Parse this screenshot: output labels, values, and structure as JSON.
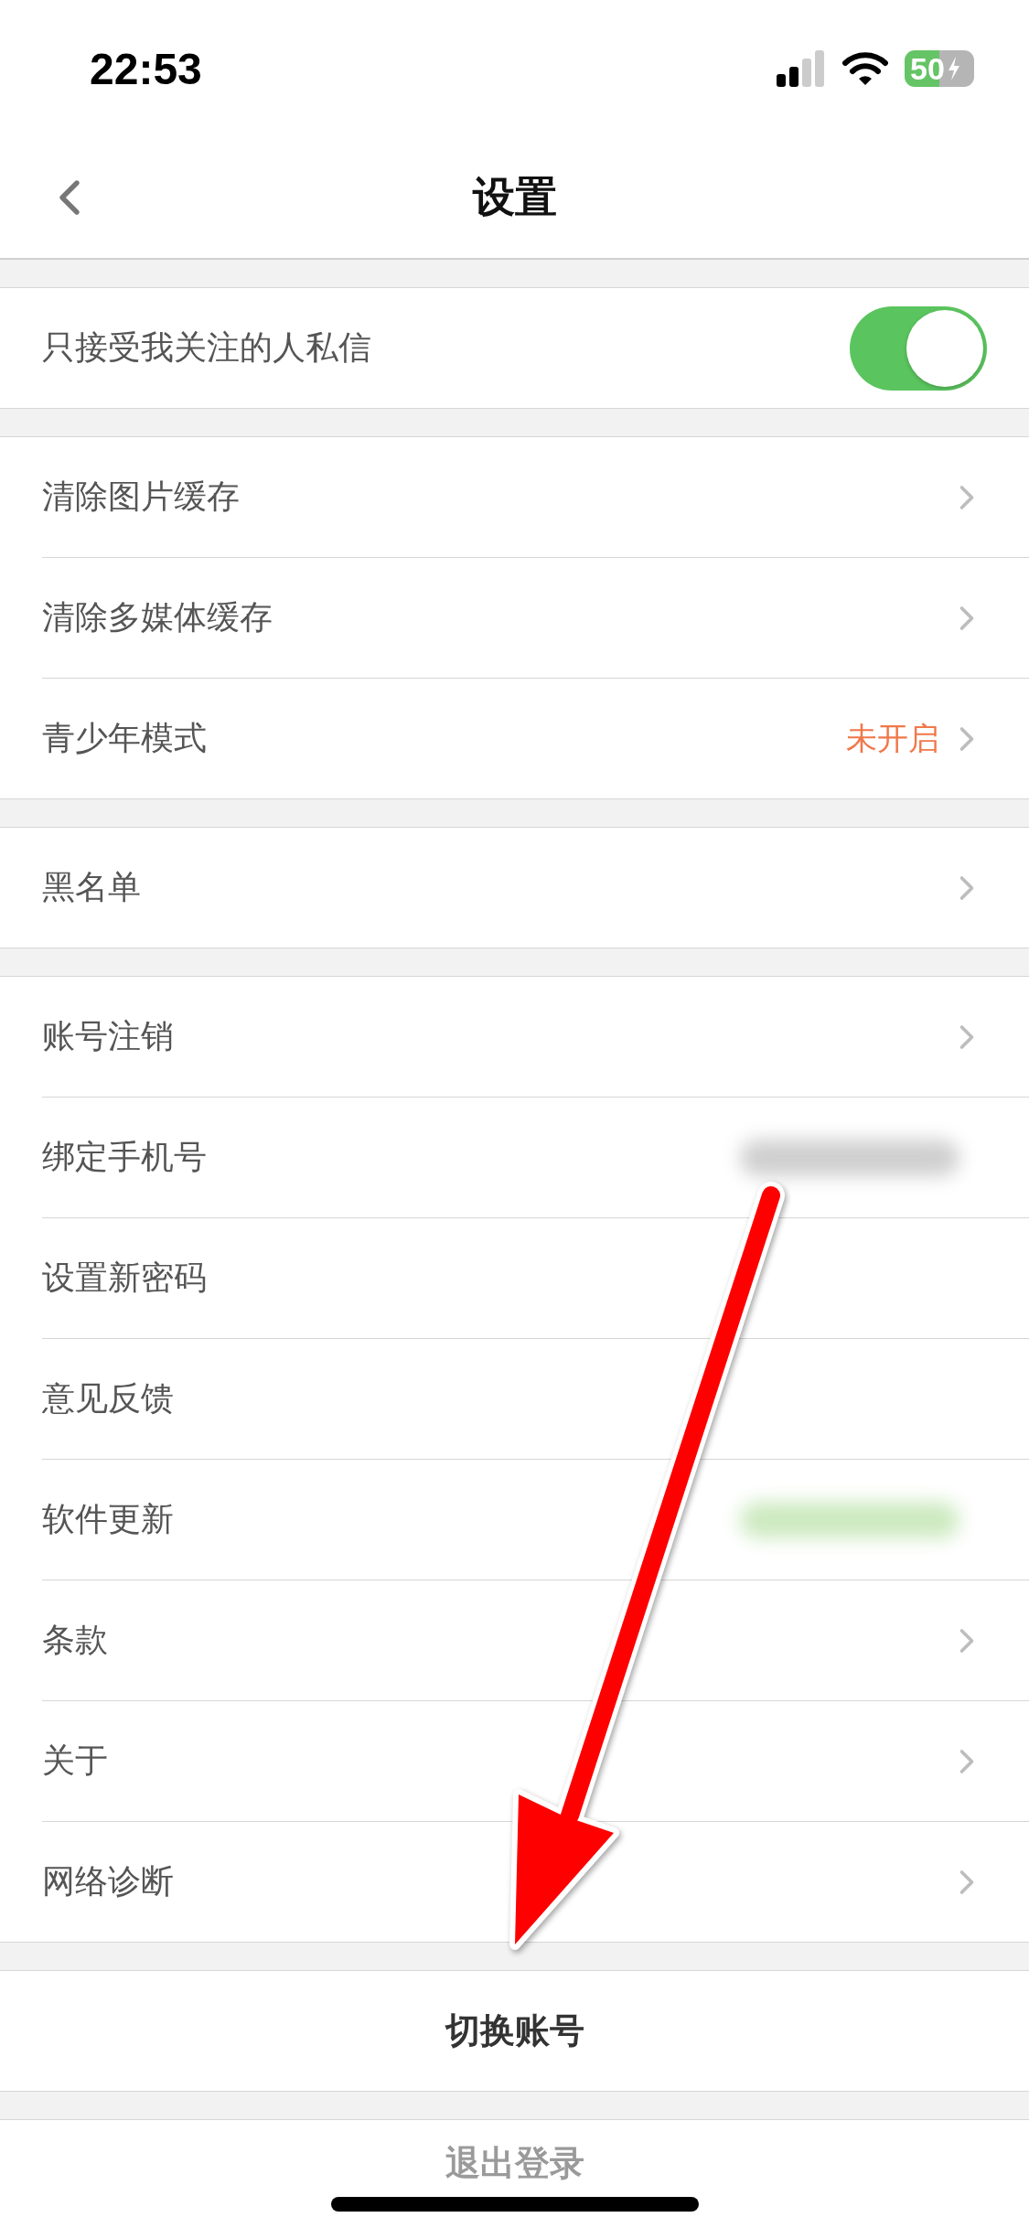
{
  "status_bar": {
    "time": "22:53",
    "battery": "50"
  },
  "nav": {
    "title": "设置"
  },
  "groups": [
    {
      "items": [
        {
          "kind": "toggle",
          "label": "只接受我关注的人私信",
          "on": true
        }
      ]
    },
    {
      "items": [
        {
          "kind": "link",
          "label": "清除图片缓存"
        },
        {
          "kind": "link",
          "label": "清除多媒体缓存"
        },
        {
          "kind": "link",
          "label": "青少年模式",
          "value": "未开启"
        }
      ]
    },
    {
      "items": [
        {
          "kind": "link",
          "label": "黑名单"
        }
      ]
    },
    {
      "items": [
        {
          "kind": "link",
          "label": "账号注销"
        },
        {
          "kind": "redacted",
          "label": "绑定手机号",
          "color": "#cfcfcf"
        },
        {
          "kind": "redacted",
          "label": "设置新密码"
        },
        {
          "kind": "redacted",
          "label": "意见反馈"
        },
        {
          "kind": "redacted",
          "label": "软件更新",
          "color": "#cdeac0"
        },
        {
          "kind": "link",
          "label": "条款"
        },
        {
          "kind": "link",
          "label": "关于"
        },
        {
          "kind": "link",
          "label": "网络诊断"
        }
      ]
    }
  ],
  "actions": [
    {
      "kind": "primary",
      "label": "切换账号"
    },
    {
      "kind": "muted",
      "label": "退出登录"
    }
  ]
}
